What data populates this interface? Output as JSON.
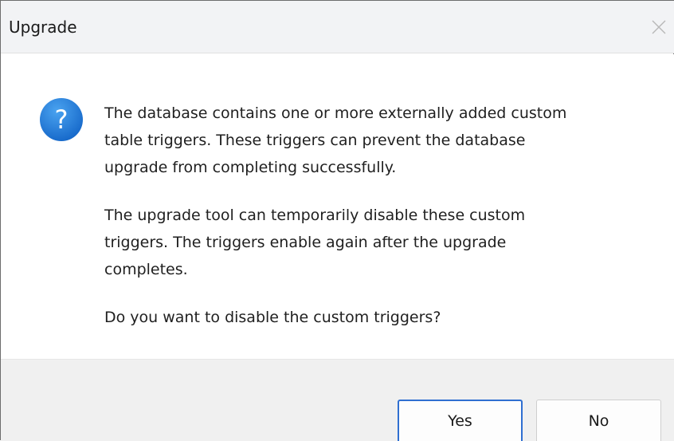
{
  "window": {
    "title": "Upgrade",
    "close_icon": "close-icon"
  },
  "dialog": {
    "icon": "question-icon",
    "icon_glyph": "?",
    "icon_color": "#1c78d4",
    "paragraphs": [
      "The database contains one or more externally added custom\ntable triggers. These triggers can prevent the database\nupgrade from completing successfully.",
      "The upgrade tool can temporarily disable these custom\ntriggers. The triggers enable again after the upgrade\ncompletes.",
      "Do you want to disable the custom triggers?"
    ]
  },
  "buttons": {
    "yes_label": "Yes",
    "no_label": "No",
    "default_accent": "#2f6fd1"
  }
}
